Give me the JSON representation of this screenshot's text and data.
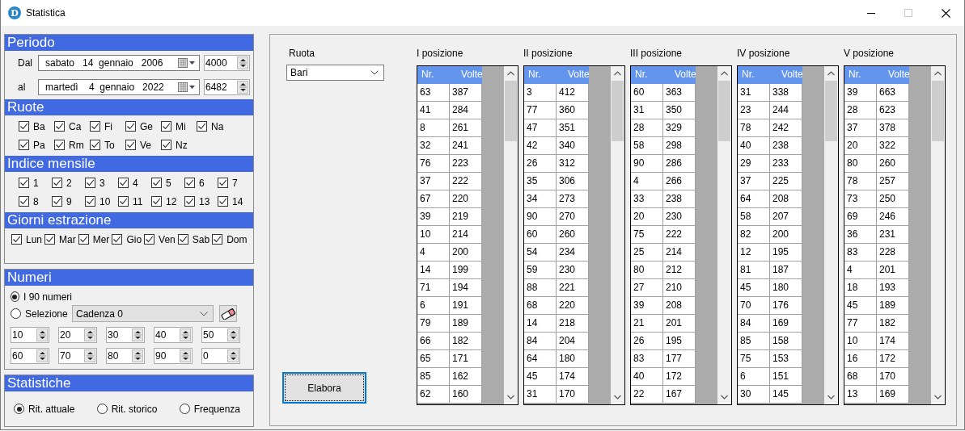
{
  "window": {
    "icon_letter": "D",
    "title": "Statistica"
  },
  "periodo": {
    "title": "Periodo",
    "rows": [
      {
        "label": "Dal",
        "date": "sabato   14  gennaio   2006",
        "number": "4000"
      },
      {
        "label": "al",
        "date": "martedì    4  gennaio   2022",
        "number": "6482"
      }
    ]
  },
  "ruote": {
    "title": "Ruote",
    "items": [
      {
        "label": "Ba",
        "checked": true
      },
      {
        "label": "Ca",
        "checked": true
      },
      {
        "label": "Fi",
        "checked": true
      },
      {
        "label": "Ge",
        "checked": true
      },
      {
        "label": "Mi",
        "checked": true
      },
      {
        "label": "Na",
        "checked": true
      },
      {
        "label": "Pa",
        "checked": true
      },
      {
        "label": "Rm",
        "checked": true
      },
      {
        "label": "To",
        "checked": true
      },
      {
        "label": "Ve",
        "checked": true
      },
      {
        "label": "Nz",
        "checked": true
      }
    ]
  },
  "indice_mensile": {
    "title": "Indice mensile",
    "items": [
      {
        "label": "1",
        "checked": true
      },
      {
        "label": "2",
        "checked": true
      },
      {
        "label": "3",
        "checked": true
      },
      {
        "label": "4",
        "checked": true
      },
      {
        "label": "5",
        "checked": true
      },
      {
        "label": "6",
        "checked": true
      },
      {
        "label": "7",
        "checked": true
      },
      {
        "label": "8",
        "checked": true
      },
      {
        "label": "9",
        "checked": true
      },
      {
        "label": "10",
        "checked": true
      },
      {
        "label": "11",
        "checked": true
      },
      {
        "label": "12",
        "checked": true
      },
      {
        "label": "13",
        "checked": true
      },
      {
        "label": "14",
        "checked": true
      }
    ]
  },
  "giorni_estrazione": {
    "title": "Giorni estrazione",
    "items": [
      {
        "label": "Lun",
        "checked": true
      },
      {
        "label": "Mar",
        "checked": true
      },
      {
        "label": "Mer",
        "checked": true
      },
      {
        "label": "Gio",
        "checked": true
      },
      {
        "label": "Ven",
        "checked": true
      },
      {
        "label": "Sab",
        "checked": true
      },
      {
        "label": "Dom",
        "checked": true
      }
    ]
  },
  "numeri": {
    "title": "Numeri",
    "options": [
      {
        "label": "I 90 numeri",
        "selected": true
      },
      {
        "label": "Selezione",
        "selected": false
      }
    ],
    "combo": "Cadenza 0",
    "numbers": [
      "10",
      "20",
      "30",
      "40",
      "50",
      "60",
      "70",
      "80",
      "90",
      "0"
    ]
  },
  "statistiche": {
    "title": "Statistiche",
    "options": [
      {
        "label": "Rit. attuale",
        "selected": true
      },
      {
        "label": "Rit. storico",
        "selected": false
      },
      {
        "label": "Frequenza",
        "selected": false
      }
    ]
  },
  "ruota": {
    "label": "Ruota",
    "value": "Bari"
  },
  "elabora_button": "Elabora",
  "positions": [
    {
      "title": "I posizione",
      "columns": [
        "Nr.",
        "Volte"
      ],
      "rows": [
        [
          "63",
          "387"
        ],
        [
          "41",
          "284"
        ],
        [
          "8",
          "261"
        ],
        [
          "32",
          "241"
        ],
        [
          "76",
          "223"
        ],
        [
          "37",
          "222"
        ],
        [
          "67",
          "220"
        ],
        [
          "39",
          "219"
        ],
        [
          "10",
          "214"
        ],
        [
          "4",
          "200"
        ],
        [
          "14",
          "199"
        ],
        [
          "71",
          "194"
        ],
        [
          "6",
          "191"
        ],
        [
          "79",
          "189"
        ],
        [
          "66",
          "182"
        ],
        [
          "65",
          "171"
        ],
        [
          "85",
          "162"
        ],
        [
          "62",
          "160"
        ]
      ]
    },
    {
      "title": "II posizione",
      "columns": [
        "Nr.",
        "Volte"
      ],
      "rows": [
        [
          "3",
          "412"
        ],
        [
          "77",
          "360"
        ],
        [
          "47",
          "351"
        ],
        [
          "42",
          "340"
        ],
        [
          "26",
          "312"
        ],
        [
          "35",
          "306"
        ],
        [
          "34",
          "273"
        ],
        [
          "90",
          "270"
        ],
        [
          "60",
          "260"
        ],
        [
          "54",
          "234"
        ],
        [
          "59",
          "230"
        ],
        [
          "88",
          "221"
        ],
        [
          "68",
          "220"
        ],
        [
          "14",
          "218"
        ],
        [
          "84",
          "204"
        ],
        [
          "64",
          "180"
        ],
        [
          "45",
          "174"
        ],
        [
          "31",
          "170"
        ]
      ]
    },
    {
      "title": "III posizione",
      "columns": [
        "Nr.",
        "Volte"
      ],
      "rows": [
        [
          "60",
          "363"
        ],
        [
          "31",
          "350"
        ],
        [
          "28",
          "329"
        ],
        [
          "58",
          "298"
        ],
        [
          "90",
          "286"
        ],
        [
          "4",
          "266"
        ],
        [
          "33",
          "238"
        ],
        [
          "20",
          "230"
        ],
        [
          "75",
          "222"
        ],
        [
          "25",
          "214"
        ],
        [
          "80",
          "212"
        ],
        [
          "27",
          "210"
        ],
        [
          "39",
          "208"
        ],
        [
          "21",
          "201"
        ],
        [
          "26",
          "195"
        ],
        [
          "83",
          "177"
        ],
        [
          "40",
          "172"
        ],
        [
          "22",
          "167"
        ]
      ]
    },
    {
      "title": "IV posizione",
      "columns": [
        "Nr.",
        "Volte"
      ],
      "rows": [
        [
          "31",
          "338"
        ],
        [
          "23",
          "244"
        ],
        [
          "78",
          "242"
        ],
        [
          "40",
          "238"
        ],
        [
          "29",
          "233"
        ],
        [
          "37",
          "225"
        ],
        [
          "64",
          "208"
        ],
        [
          "58",
          "207"
        ],
        [
          "82",
          "200"
        ],
        [
          "12",
          "195"
        ],
        [
          "81",
          "187"
        ],
        [
          "45",
          "180"
        ],
        [
          "70",
          "176"
        ],
        [
          "84",
          "169"
        ],
        [
          "85",
          "158"
        ],
        [
          "75",
          "153"
        ],
        [
          "6",
          "151"
        ],
        [
          "30",
          "145"
        ]
      ]
    },
    {
      "title": "V posizione",
      "columns": [
        "Nr.",
        "Volte"
      ],
      "rows": [
        [
          "39",
          "663"
        ],
        [
          "28",
          "623"
        ],
        [
          "37",
          "378"
        ],
        [
          "20",
          "322"
        ],
        [
          "80",
          "260"
        ],
        [
          "78",
          "257"
        ],
        [
          "73",
          "250"
        ],
        [
          "69",
          "246"
        ],
        [
          "36",
          "231"
        ],
        [
          "83",
          "228"
        ],
        [
          "4",
          "201"
        ],
        [
          "18",
          "193"
        ],
        [
          "45",
          "189"
        ],
        [
          "77",
          "182"
        ],
        [
          "10",
          "174"
        ],
        [
          "16",
          "172"
        ],
        [
          "68",
          "170"
        ],
        [
          "13",
          "169"
        ]
      ]
    }
  ]
}
